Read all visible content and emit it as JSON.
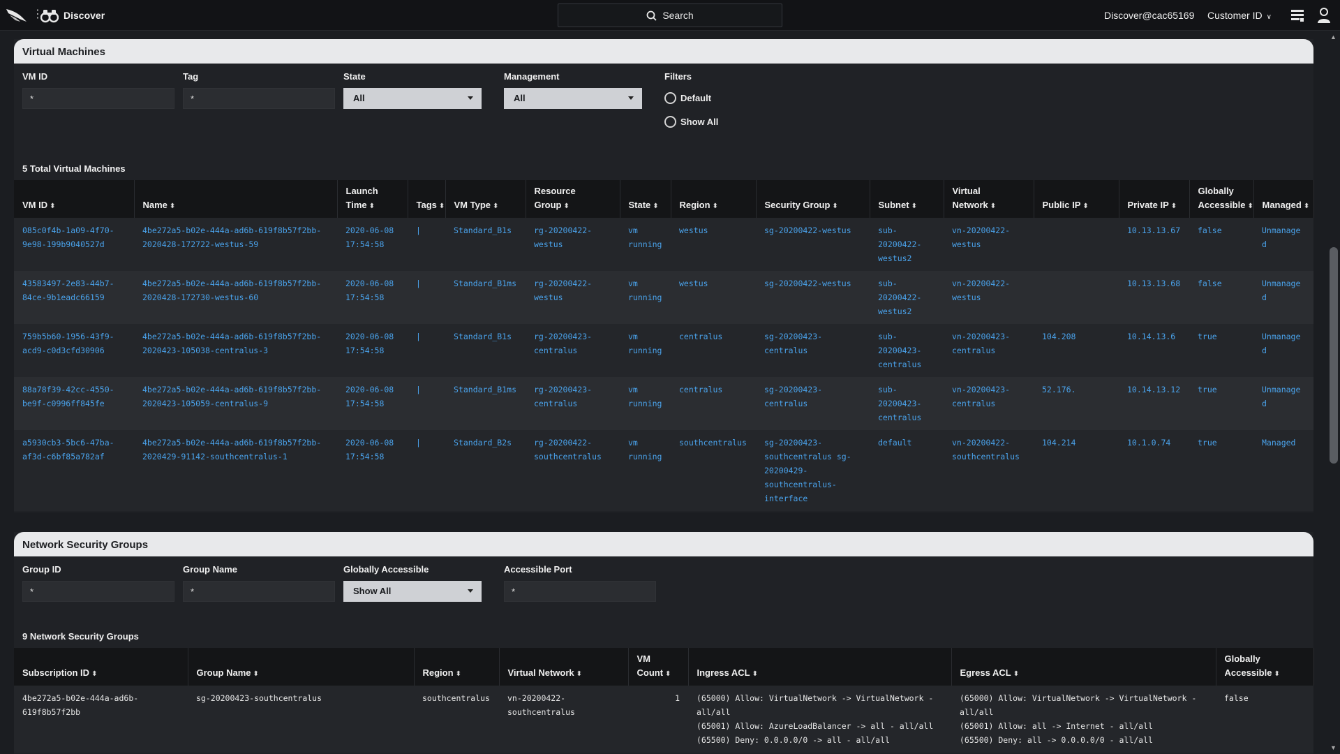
{
  "topbar": {
    "app_title": "Discover",
    "search_label": "Search",
    "user": "Discover@cac65169",
    "customer_label": "Customer ID"
  },
  "vm_panel": {
    "title": "Virtual Machines",
    "filters": {
      "vm_id": {
        "label": "VM ID",
        "value": "*"
      },
      "tag": {
        "label": "Tag",
        "value": "*"
      },
      "state": {
        "label": "State",
        "value": "All"
      },
      "management": {
        "label": "Management",
        "value": "All"
      },
      "filters_label": "Filters",
      "radio_default": "Default",
      "radio_show_all": "Show All"
    },
    "count_title": "5 Total Virtual Machines",
    "columns": [
      "VM ID",
      "Name",
      "Launch Time",
      "Tags",
      "VM Type",
      "Resource Group",
      "State",
      "Region",
      "Security Group",
      "Subnet",
      "Virtual Network",
      "Public IP",
      "Private IP",
      "Globally Accessible",
      "Managed"
    ],
    "rows": [
      {
        "vm_id": "085c0f4b-1a09-4f70-9e98-199b9040527d",
        "name": "4be272a5-b02e-444a-ad6b-619f8b57f2bb-2020428-172722-westus-59",
        "launch": "2020-06-08 17:54:58",
        "tags": "|",
        "type": "Standard_B1s",
        "rg": "rg-20200422-westus",
        "state": "vm running",
        "region": "westus",
        "sg": "sg-20200422-westus",
        "subnet": "sub-20200422-westus2",
        "vnet": "vn-20200422-westus",
        "public_ip": "",
        "private_ip": "10.13.13.67",
        "global": "false",
        "managed": "Unmanaged"
      },
      {
        "vm_id": "43583497-2e83-44b7-84ce-9b1eadc66159",
        "name": "4be272a5-b02e-444a-ad6b-619f8b57f2bb-2020428-172730-westus-60",
        "launch": "2020-06-08 17:54:58",
        "tags": "|",
        "type": "Standard_B1ms",
        "rg": "rg-20200422-westus",
        "state": "vm running",
        "region": "westus",
        "sg": "sg-20200422-westus",
        "subnet": "sub-20200422-westus2",
        "vnet": "vn-20200422-westus",
        "public_ip": "",
        "private_ip": "10.13.13.68",
        "global": "false",
        "managed": "Unmanaged"
      },
      {
        "vm_id": "759b5b60-1956-43f9-acd9-c0d3cfd30906",
        "name": "4be272a5-b02e-444a-ad6b-619f8b57f2bb-2020423-105038-centralus-3",
        "launch": "2020-06-08 17:54:58",
        "tags": "|",
        "type": "Standard_B1s",
        "rg": "rg-20200423-centralus",
        "state": "vm running",
        "region": "centralus",
        "sg": "sg-20200423-centralus",
        "subnet": "sub-20200423-centralus",
        "vnet": "vn-20200423-centralus",
        "public_ip": "104.208",
        "private_ip": "10.14.13.6",
        "global": "true",
        "managed": "Unmanaged"
      },
      {
        "vm_id": "88a78f39-42cc-4550-be9f-c0996ff845fe",
        "name": "4be272a5-b02e-444a-ad6b-619f8b57f2bb-2020423-105059-centralus-9",
        "launch": "2020-06-08 17:54:58",
        "tags": "|",
        "type": "Standard_B1ms",
        "rg": "rg-20200423-centralus",
        "state": "vm running",
        "region": "centralus",
        "sg": "sg-20200423-centralus",
        "subnet": "sub-20200423-centralus",
        "vnet": "vn-20200423-centralus",
        "public_ip": "52.176.",
        "private_ip": "10.14.13.12",
        "global": "true",
        "managed": "Unmanaged"
      },
      {
        "vm_id": "a5930cb3-5bc6-47ba-af3d-c6bf85a782af",
        "name": "4be272a5-b02e-444a-ad6b-619f8b57f2bb-2020429-91142-southcentralus-1",
        "launch": "2020-06-08 17:54:58",
        "tags": "|",
        "type": "Standard_B2s",
        "rg": "rg-20200422-southcentralus",
        "state": "vm running",
        "region": "southcentralus",
        "sg": "sg-20200423-southcentralus sg-20200429-southcentralus-interface",
        "subnet": "default",
        "vnet": "vn-20200422-southcentralus",
        "public_ip": "104.214",
        "private_ip": "10.1.0.74",
        "global": "true",
        "managed": "Managed"
      }
    ]
  },
  "nsg_panel": {
    "title": "Network Security Groups",
    "filters": {
      "group_id": {
        "label": "Group ID",
        "value": "*"
      },
      "group_name": {
        "label": "Group Name",
        "value": "*"
      },
      "globally_accessible": {
        "label": "Globally Accessible",
        "value": "Show All"
      },
      "accessible_port": {
        "label": "Accessible Port",
        "value": "*"
      }
    },
    "count_title": "9 Network Security Groups",
    "columns": [
      "Subscription ID",
      "Group Name",
      "Region",
      "Virtual Network",
      "VM Count",
      "Ingress ACL",
      "Egress ACL",
      "Globally Accessible"
    ],
    "rows": [
      {
        "sub_id": "4be272a5-b02e-444a-ad6b-619f8b57f2bb",
        "group": "sg-20200423-southcentralus",
        "region": "southcentralus",
        "vnet": "vn-20200422-southcentralus",
        "vm_count": "1",
        "ingress": "(65000) Allow: VirtualNetwork -> VirtualNetwork - all/all\n(65001) Allow: AzureLoadBalancer -> all - all/all\n(65500) Deny: 0.0.0.0/0 -> all - all/all",
        "egress": "(65000) Allow: VirtualNetwork -> VirtualNetwork - all/all\n(65001) Allow: all -> Internet - all/all\n(65500) Deny: all -> 0.0.0.0/0 - all/all",
        "global": "false"
      }
    ]
  }
}
